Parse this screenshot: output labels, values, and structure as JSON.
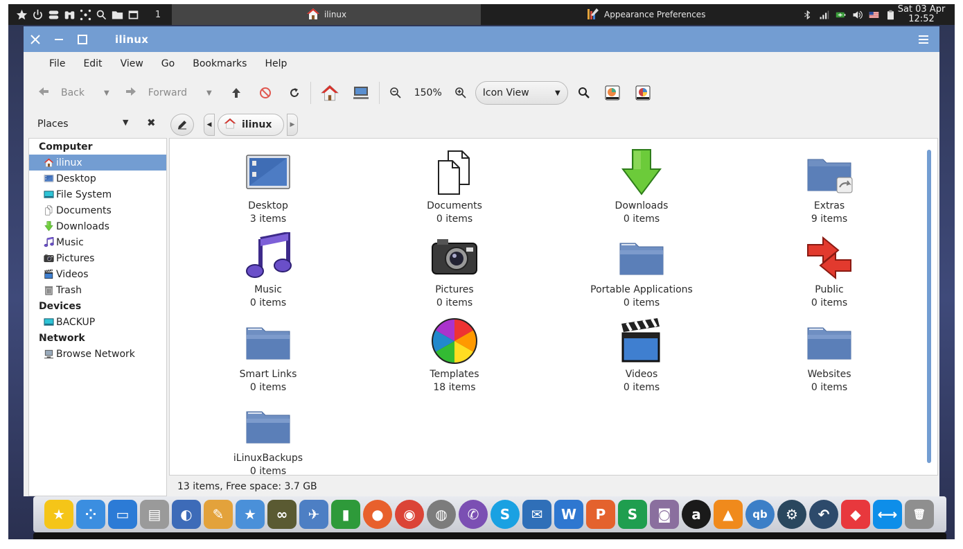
{
  "top_panel": {
    "launcher_icons": [
      "star-icon",
      "power-icon",
      "toggle-icon",
      "binoculars-icon",
      "network-icon",
      "search-icon",
      "folder-icon",
      "window-icon"
    ],
    "workspace": "1",
    "active_task": "ilinux",
    "other_task": "Appearance Preferences",
    "tray_icons": [
      "bluetooth-icon",
      "signal-icon",
      "battery-icon",
      "volume-icon",
      "flag-icon",
      "clipboard-icon"
    ],
    "clock_date": "Sat 03 Apr",
    "clock_time": "12:52"
  },
  "window": {
    "title": "ilinux",
    "close_label": "✕",
    "minimize_label": "–",
    "maximize_label": "☐"
  },
  "menubar": [
    "File",
    "Edit",
    "View",
    "Go",
    "Bookmarks",
    "Help"
  ],
  "toolbar": {
    "back_label": "Back",
    "forward_label": "Forward",
    "zoom_level": "150%",
    "view_mode": "Icon View"
  },
  "places": {
    "label": "Places",
    "sections": [
      {
        "heading": "Computer",
        "items": [
          {
            "label": "ilinux",
            "icon": "home-icon",
            "selected": true
          },
          {
            "label": "Desktop",
            "icon": "desktop-icon"
          },
          {
            "label": "File System",
            "icon": "drive-icon"
          },
          {
            "label": "Documents",
            "icon": "documents-icon"
          },
          {
            "label": "Downloads",
            "icon": "downloads-icon"
          },
          {
            "label": "Music",
            "icon": "music-icon"
          },
          {
            "label": "Pictures",
            "icon": "camera-icon"
          },
          {
            "label": "Videos",
            "icon": "clapper-icon"
          },
          {
            "label": "Trash",
            "icon": "trash-icon"
          }
        ]
      },
      {
        "heading": "Devices",
        "items": [
          {
            "label": "BACKUP",
            "icon": "drive-icon"
          }
        ]
      },
      {
        "heading": "Network",
        "items": [
          {
            "label": "Browse Network",
            "icon": "network-icon"
          }
        ]
      }
    ]
  },
  "breadcrumb": {
    "current": "ilinux"
  },
  "files": [
    {
      "name": "Desktop",
      "count": "3 items",
      "icon": "desktop-icon"
    },
    {
      "name": "Documents",
      "count": "0 items",
      "icon": "documents-icon"
    },
    {
      "name": "Downloads",
      "count": "0 items",
      "icon": "downloads-icon"
    },
    {
      "name": "Extras",
      "count": "9 items",
      "icon": "folder-link-icon"
    },
    {
      "name": "Music",
      "count": "0 items",
      "icon": "music-icon"
    },
    {
      "name": "Pictures",
      "count": "0 items",
      "icon": "camera-icon"
    },
    {
      "name": "Portable Applications",
      "count": "0 items",
      "icon": "folder-icon"
    },
    {
      "name": "Public",
      "count": "0 items",
      "icon": "public-icon"
    },
    {
      "name": "Smart Links",
      "count": "0 items",
      "icon": "folder-icon"
    },
    {
      "name": "Templates",
      "count": "18 items",
      "icon": "color-wheel-icon"
    },
    {
      "name": "Videos",
      "count": "0 items",
      "icon": "clapper-icon"
    },
    {
      "name": "Websites",
      "count": "0 items",
      "icon": "folder-icon"
    },
    {
      "name": "iLinuxBackups",
      "count": "0 items",
      "icon": "folder-icon"
    }
  ],
  "status": "13 items, Free space: 3.7 GB",
  "dock": [
    {
      "name": "star-icon",
      "color": "#f5c518",
      "glyph": "★"
    },
    {
      "name": "dots-icon",
      "color": "#3b8ee0",
      "glyph": "⁘"
    },
    {
      "name": "window-icon",
      "color": "#2c7bd6",
      "glyph": "▭"
    },
    {
      "name": "cabinet-icon",
      "color": "#9a9a9a",
      "glyph": "▤"
    },
    {
      "name": "toggle-icon",
      "color": "#3d6bb8",
      "glyph": "◐"
    },
    {
      "name": "palette-icon",
      "color": "#e3a23b",
      "glyph": "✎"
    },
    {
      "name": "store-icon",
      "color": "#4a90d9",
      "glyph": "★"
    },
    {
      "name": "binoculars-icon",
      "color": "#5a5a32",
      "glyph": "∞"
    },
    {
      "name": "plane-icon",
      "color": "#4d7fc4",
      "glyph": "✈"
    },
    {
      "name": "pipe-icon",
      "color": "#2e9a3a",
      "glyph": "▮"
    },
    {
      "name": "firefox-icon",
      "color": "#e8602c",
      "glyph": "●"
    },
    {
      "name": "chrome-icon",
      "color": "#db4437",
      "glyph": "◉"
    },
    {
      "name": "earth-pro-icon",
      "color": "#7c7c7c",
      "glyph": "◍"
    },
    {
      "name": "viber-icon",
      "color": "#7b4fb3",
      "glyph": "✆"
    },
    {
      "name": "skype-icon",
      "color": "#1aa1e2",
      "glyph": "S"
    },
    {
      "name": "mail-icon",
      "color": "#2f6fb8",
      "glyph": "✉"
    },
    {
      "name": "writer-icon",
      "color": "#2e77d0",
      "glyph": "W"
    },
    {
      "name": "presentation-icon",
      "color": "#e4622d",
      "glyph": "P"
    },
    {
      "name": "spreadsheet-icon",
      "color": "#1f9e4f",
      "glyph": "S"
    },
    {
      "name": "screenshot-icon",
      "color": "#8a6f9e",
      "glyph": "◙"
    },
    {
      "name": "amazon-icon",
      "color": "#1a1a1a",
      "glyph": "a"
    },
    {
      "name": "vlc-icon",
      "color": "#f08a1c",
      "glyph": "▲"
    },
    {
      "name": "qbittorrent-icon",
      "color": "#3c7fc7",
      "glyph": "qb"
    },
    {
      "name": "steam-icon",
      "color": "#2a475e",
      "glyph": "⚙"
    },
    {
      "name": "backup-icon",
      "color": "#2d4a6b",
      "glyph": "↶"
    },
    {
      "name": "anydesk-icon",
      "color": "#e8383d",
      "glyph": "◆"
    },
    {
      "name": "teamviewer-icon",
      "color": "#0e8ee9",
      "glyph": "⟷"
    },
    {
      "name": "trash-icon",
      "color": "#8f8f8f",
      "glyph": "🗑"
    }
  ],
  "colors": {
    "accent": "#739dd2",
    "titlebar_text": "#ffffff",
    "panel": "#1f1f1f"
  }
}
